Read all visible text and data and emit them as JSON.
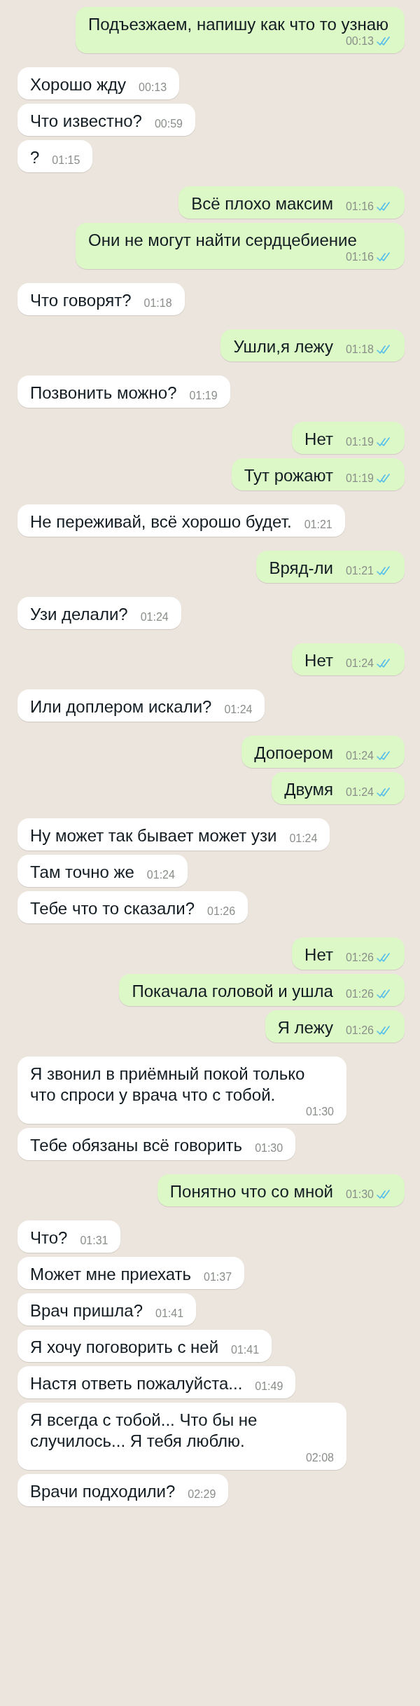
{
  "messages": [
    {
      "kind": "sent",
      "text": "Подъезжаем, напишу как что то узнаю",
      "time": "00:13",
      "read": true
    },
    {
      "kind": "received",
      "text": "Хорошо жду",
      "time": "00:13"
    },
    {
      "kind": "received",
      "text": "Что известно?",
      "time": "00:59"
    },
    {
      "kind": "received",
      "text": "?",
      "time": "01:15"
    },
    {
      "kind": "sent",
      "text": "Всё плохо максим",
      "time": "01:16",
      "read": true
    },
    {
      "kind": "sent",
      "text": "Они не могут найти сердцебиение",
      "time": "01:16",
      "read": true
    },
    {
      "kind": "received",
      "text": "Что говорят?",
      "time": "01:18"
    },
    {
      "kind": "sent",
      "text": "Ушли,я лежу",
      "time": "01:18",
      "read": true
    },
    {
      "kind": "received",
      "text": "Позвонить можно?",
      "time": "01:19"
    },
    {
      "kind": "sent",
      "text": "Нет",
      "time": "01:19",
      "read": true
    },
    {
      "kind": "sent",
      "text": "Тут рожают",
      "time": "01:19",
      "read": true
    },
    {
      "kind": "received",
      "text": "Не переживай, всё хорошо будет.",
      "time": "01:21"
    },
    {
      "kind": "sent",
      "text": "Вряд-ли",
      "time": "01:21",
      "read": true
    },
    {
      "kind": "received",
      "text": "Узи делали?",
      "time": "01:24"
    },
    {
      "kind": "sent",
      "text": "Нет",
      "time": "01:24",
      "read": true
    },
    {
      "kind": "received",
      "text": "Или доплером искали?",
      "time": "01:24"
    },
    {
      "kind": "sent",
      "text": "Допоером",
      "time": "01:24",
      "read": true
    },
    {
      "kind": "sent",
      "text": "Двумя",
      "time": "01:24",
      "read": true
    },
    {
      "kind": "received",
      "text": "Ну может так бывает может узи",
      "time": "01:24"
    },
    {
      "kind": "received",
      "text": "Там точно же",
      "time": "01:24"
    },
    {
      "kind": "received",
      "text": "Тебе что то сказали?",
      "time": "01:26"
    },
    {
      "kind": "sent",
      "text": "Нет",
      "time": "01:26",
      "read": true
    },
    {
      "kind": "sent",
      "text": "Покачала головой и ушла",
      "time": "01:26",
      "read": true
    },
    {
      "kind": "sent",
      "text": "Я лежу",
      "time": "01:26",
      "read": true
    },
    {
      "kind": "received",
      "text": "Я звонил в приёмный покой только что спроси у врача что с тобой.",
      "time": "01:30"
    },
    {
      "kind": "received",
      "text": "Тебе обязаны всё говорить",
      "time": "01:30"
    },
    {
      "kind": "sent",
      "text": "Понятно что со мной",
      "time": "01:30",
      "read": true
    },
    {
      "kind": "received",
      "text": "Что?",
      "time": "01:31"
    },
    {
      "kind": "received",
      "text": "Может мне приехать",
      "time": "01:37"
    },
    {
      "kind": "received",
      "text": "Врач пришла?",
      "time": "01:41"
    },
    {
      "kind": "received",
      "text": "Я хочу поговорить с ней",
      "time": "01:41"
    },
    {
      "kind": "received",
      "text": "Настя ответь пожалуйста...",
      "time": "01:49"
    },
    {
      "kind": "received",
      "text": "Я всегда с тобой... Что бы не случилось... Я тебя люблю.",
      "time": "02:08"
    },
    {
      "kind": "received",
      "text": "Врачи подходили?",
      "time": "02:29"
    }
  ]
}
